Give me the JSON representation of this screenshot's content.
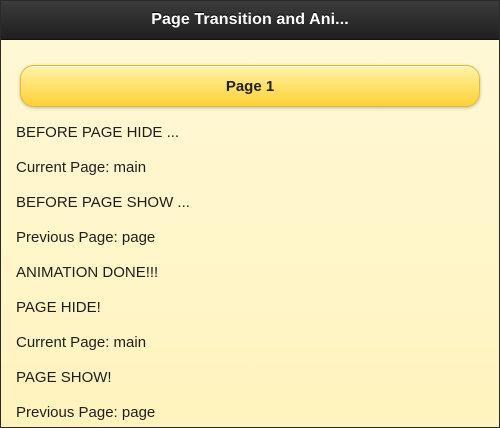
{
  "header": {
    "title": "Page Transition and Ani..."
  },
  "page_button": {
    "label": "Page 1"
  },
  "log": [
    "BEFORE PAGE HIDE ...",
    "Current Page: main",
    "BEFORE PAGE SHOW ...",
    "Previous Page: page",
    "ANIMATION DONE!!!",
    "PAGE HIDE!",
    "Current Page: main",
    "PAGE SHOW!",
    "Previous Page: page"
  ],
  "colors": {
    "header_bg": "#2a2a2a",
    "button_fill": "#ffe066",
    "page_bg": "#fff6cc"
  }
}
